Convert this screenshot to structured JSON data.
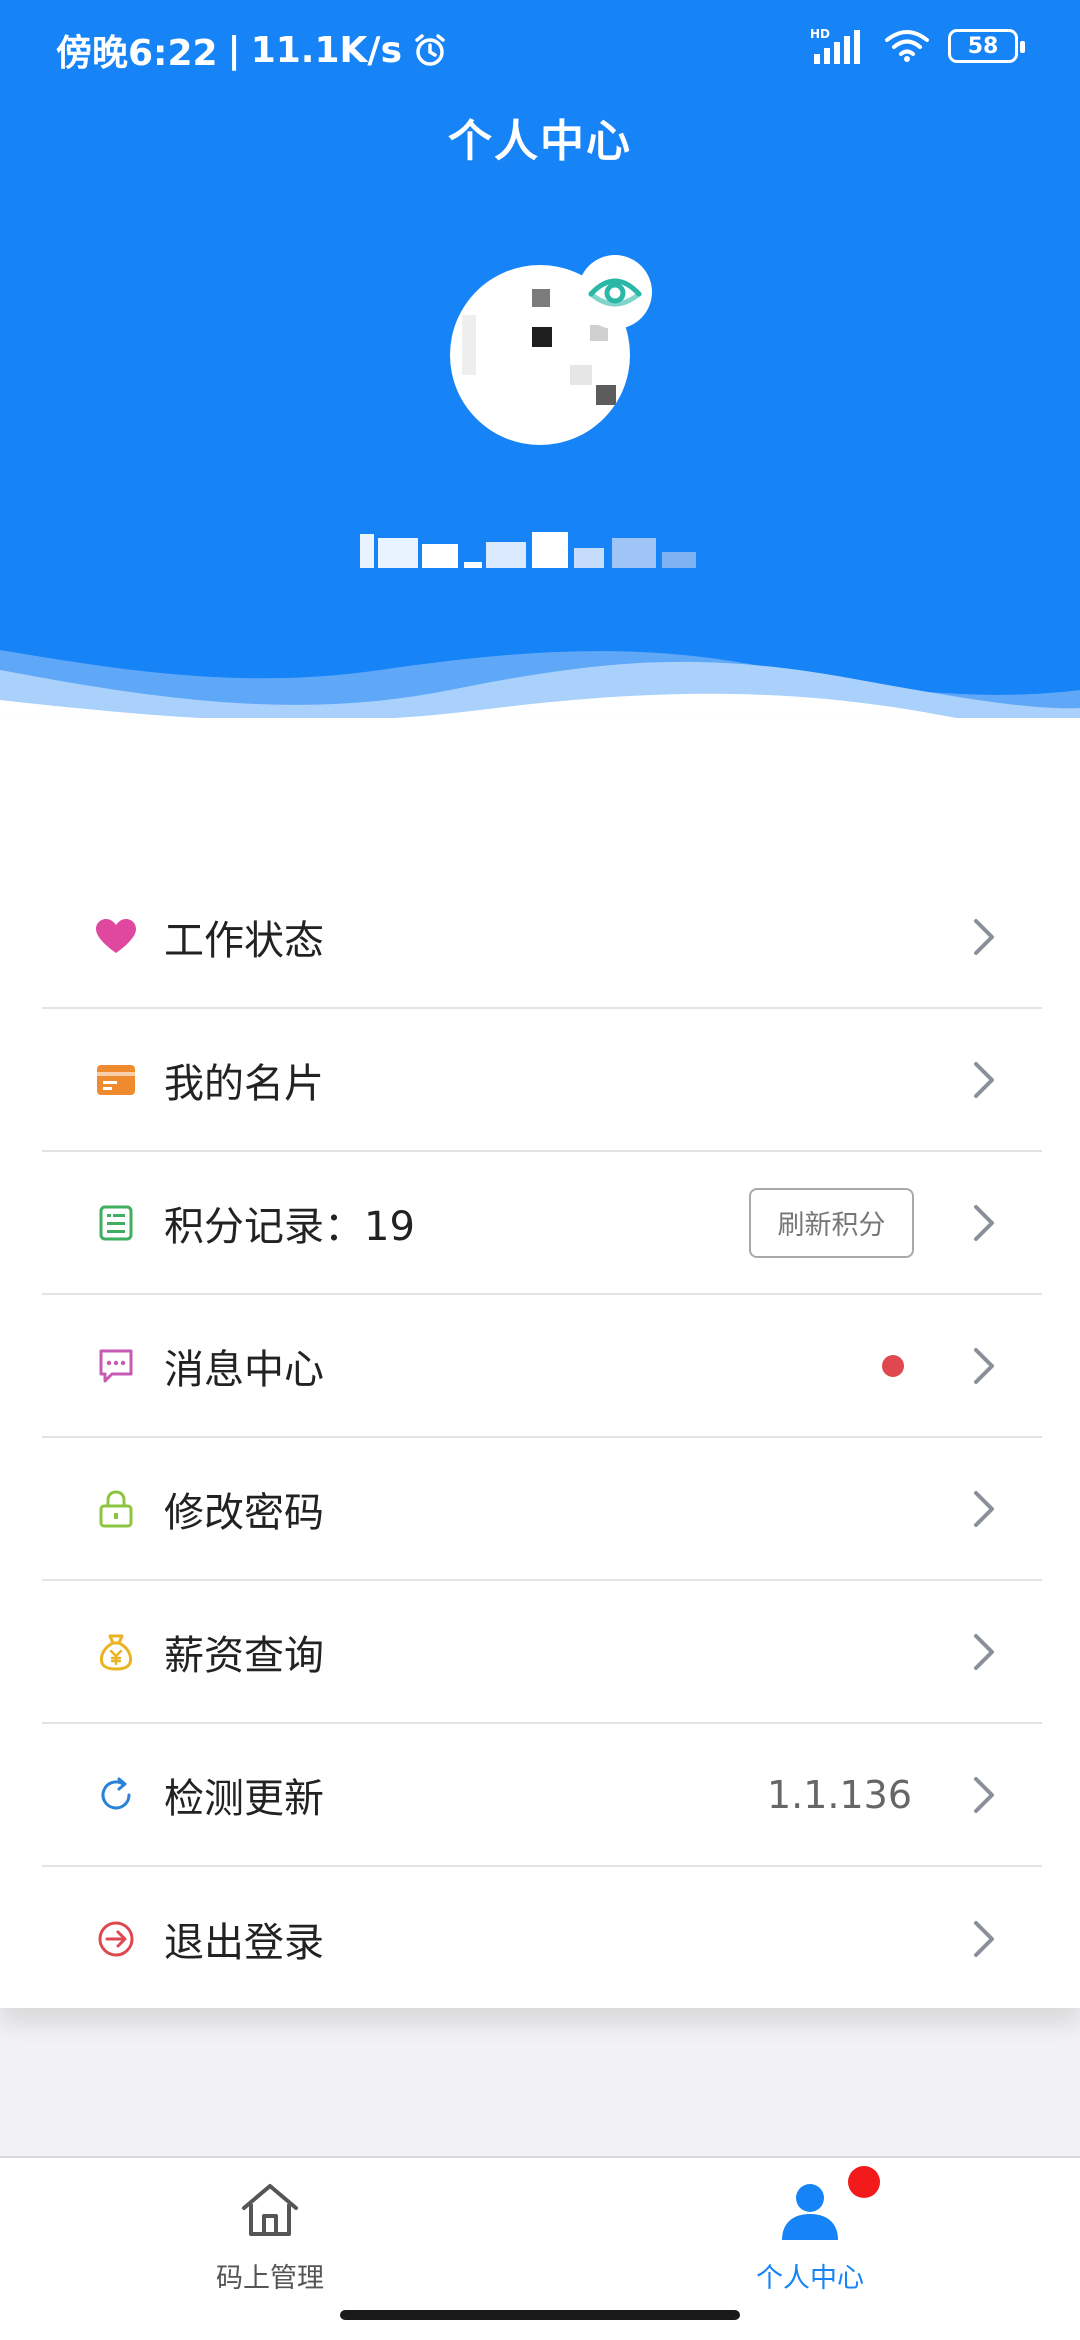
{
  "status_bar": {
    "time": "傍晚6:22",
    "speed": "11.1K/s",
    "network": "HD",
    "battery": "58"
  },
  "header": {
    "title": "个人中心"
  },
  "menu": {
    "items": [
      {
        "label": "工作状态",
        "icon": "heart-icon",
        "color": "#e0479e"
      },
      {
        "label": "我的名片",
        "icon": "card-icon",
        "color": "#f08a2e"
      },
      {
        "label": "积分记录：19",
        "icon": "points-icon",
        "color": "#3fae5f",
        "button": "刷新积分"
      },
      {
        "label": "消息中心",
        "icon": "message-icon",
        "color": "#c85ab4",
        "badge": "red-dot"
      },
      {
        "label": "修改密码",
        "icon": "lock-icon",
        "color": "#8cc63f"
      },
      {
        "label": "薪资查询",
        "icon": "money-bag-icon",
        "color": "#e9b322"
      },
      {
        "label": "检测更新",
        "icon": "refresh-icon",
        "color": "#2a82d8",
        "value": "1.1.136"
      },
      {
        "label": "退出登录",
        "icon": "logout-icon",
        "color": "#e0484f"
      }
    ]
  },
  "bottom_nav": {
    "items": [
      {
        "label": "码上管理",
        "icon": "home-icon",
        "active": false
      },
      {
        "label": "个人中心",
        "icon": "user-icon",
        "active": true
      }
    ]
  },
  "colors": {
    "primary": "#1683f6",
    "active_nav": "#1683f6",
    "inactive_nav": "#555555",
    "badge": "#f21a1a"
  }
}
